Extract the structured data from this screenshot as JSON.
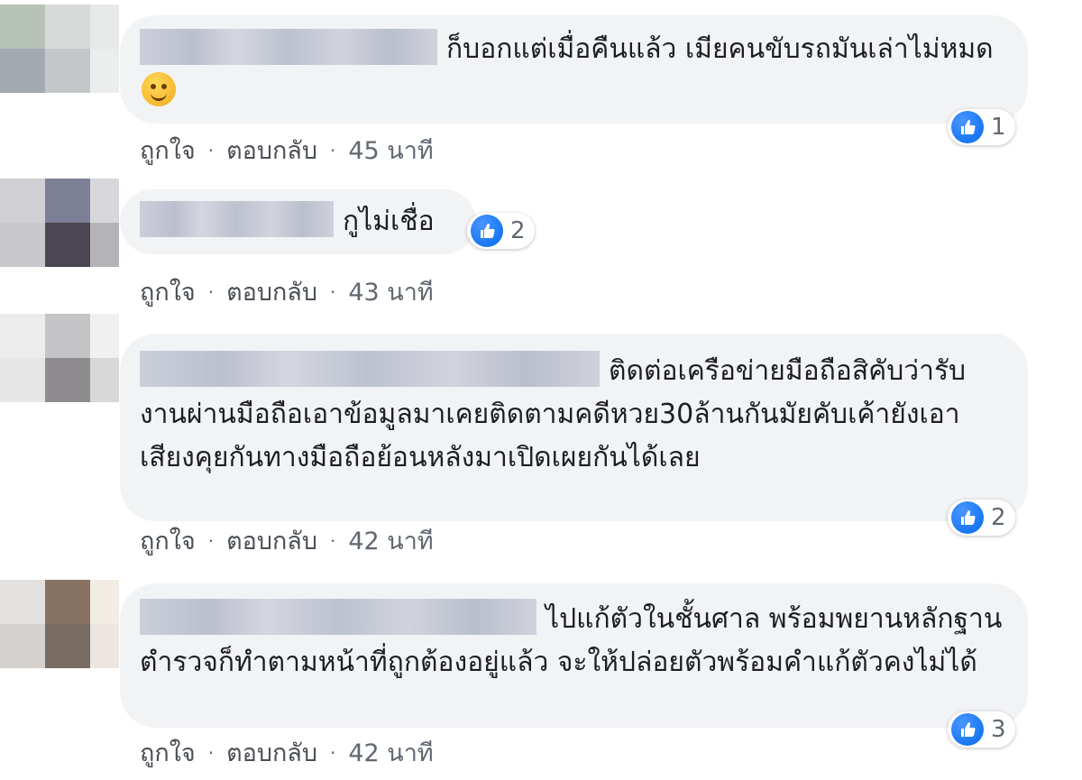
{
  "comments": [
    {
      "text": "ก็บอกแต่เมื่อคืนแล้ว เมียคนขับรถมันเล่าไม่หมด",
      "reactions": "1",
      "like": "ถูกใจ",
      "reply": "ตอบกลับ",
      "time": "45 นาที",
      "avatar_colors": [
        "#b7c2b6",
        "#d6dad8",
        "#e7e9e8",
        "#a5aab0",
        "#c4c7ca",
        "#eceeee"
      ]
    },
    {
      "text": "กูไม่เชื่อ",
      "reactions": "2",
      "like": "ถูกใจ",
      "reply": "ตอบกลับ",
      "time": "43 นาที",
      "avatar_colors": [
        "#d0d0d4",
        "#7c7f96",
        "#d7d7db",
        "#c8c8cc",
        "#4b4651",
        "#b4b4b8"
      ]
    },
    {
      "text": "ติดต่อเครือข่ายมือถือสิคับว่ารับงานผ่านมือถือเอาข้อมูลมาเคยติดตามคดีหวย30ล้านกันมัยคับเค้ายังเอาเสียงคุยกันทางมือถือย้อนหลังมาเปิดเผยกันได้เลย",
      "reactions": "2",
      "like": "ถูกใจ",
      "reply": "ตอบกลับ",
      "time": "42 นาที",
      "avatar_colors": [
        "#ececec",
        "#c5c5c7",
        "#f0f0f0",
        "#e6e6e6",
        "#8e8c8e",
        "#d8d8d8"
      ]
    },
    {
      "text": "ไปแก้ตัวในชั้นศาล พร้อมพยานหลักฐาน ตำรวจก็ทำตามหน้าที่ถูกต้องอยู่แล้ว จะให้ปล่อยตัวพร้อมคำแก้ตัวคงไม่ได้",
      "reactions": "3",
      "like": "ถูกใจ",
      "reply": "ตอบกลับ",
      "time": "42 นาที",
      "avatar_colors": [
        "#e3e1df",
        "#877262",
        "#f3ece5",
        "#d4d1cf",
        "#7a6c62",
        "#ebe6e1"
      ]
    }
  ],
  "colors": {
    "bubble": "#f2f3f5",
    "like_blue": "#1877f2",
    "meta_text": "#606770"
  },
  "icons": {
    "like": "thumbs-up-icon",
    "emoji": "smiling-face-icon"
  }
}
